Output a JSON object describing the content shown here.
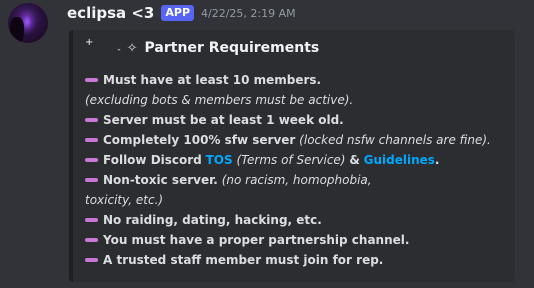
{
  "message": {
    "username": "eclipsa <3",
    "badge": "APP",
    "timestamp": "4/22/25, 2:19 AM"
  },
  "embed": {
    "title_sparkles": [
      "+",
      "-",
      "✧"
    ],
    "title": "Partner Requirements",
    "items": [
      {
        "bold": "Must have at least 10 members."
      },
      {
        "italic_line": "(excluding bots & members must be active)."
      },
      {
        "bold": "Server must be at least 1 week old."
      },
      {
        "bold": "Completely 100% sfw server",
        "italic": "(locked nsfw channels are fine)."
      },
      {
        "bold_a": "Follow Discord",
        "link_tos": "TOS",
        "italic_tos": "(Terms of Service)",
        "amp": "&",
        "link_guidelines": "Guidelines",
        "period": "."
      },
      {
        "bold": "Non-toxic server.",
        "italic": "(no racism, homophobia,"
      },
      {
        "italic_line": "toxicity, etc.)"
      },
      {
        "bold": "No raiding, dating, hacking, etc."
      },
      {
        "bold": "You must have a proper partnership channel."
      },
      {
        "bold": "A trusted staff member must join for rep."
      }
    ]
  },
  "colors": {
    "background": "#313338",
    "embed_bg": "#2b2d31",
    "badge": "#5865f2",
    "dash": "#c977d6",
    "link": "#00a8fc"
  }
}
